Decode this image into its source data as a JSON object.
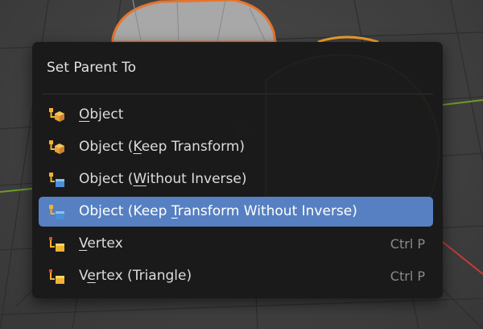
{
  "menu": {
    "title": "Set Parent To",
    "items": [
      {
        "label": "Object",
        "underline": 0,
        "icon": "parent-object-icon",
        "shortcut": ""
      },
      {
        "label": "Object (Keep Transform)",
        "underline": 8,
        "icon": "parent-object-icon",
        "shortcut": ""
      },
      {
        "label": "Object (Without Inverse)",
        "underline": 8,
        "icon": "parent-without-inverse-icon",
        "shortcut": ""
      },
      {
        "label": "Object (Keep Transform Without Inverse)",
        "underline": 13,
        "icon": "parent-without-inverse-icon",
        "shortcut": "",
        "active": true
      },
      {
        "label": "Vertex",
        "underline": 0,
        "icon": "parent-vertex-icon",
        "shortcut": "Ctrl P"
      },
      {
        "label": "Vertex (Triangle)",
        "underline": 1,
        "icon": "parent-vertex-icon",
        "shortcut": "Ctrl P"
      }
    ]
  },
  "colors": {
    "menu_bg": "#181818",
    "highlight": "#5680c2",
    "selection_outline": "#e8742a",
    "active_outline": "#f0a030",
    "axis_red": "#c43a3a",
    "axis_green": "#6a9a2a"
  }
}
